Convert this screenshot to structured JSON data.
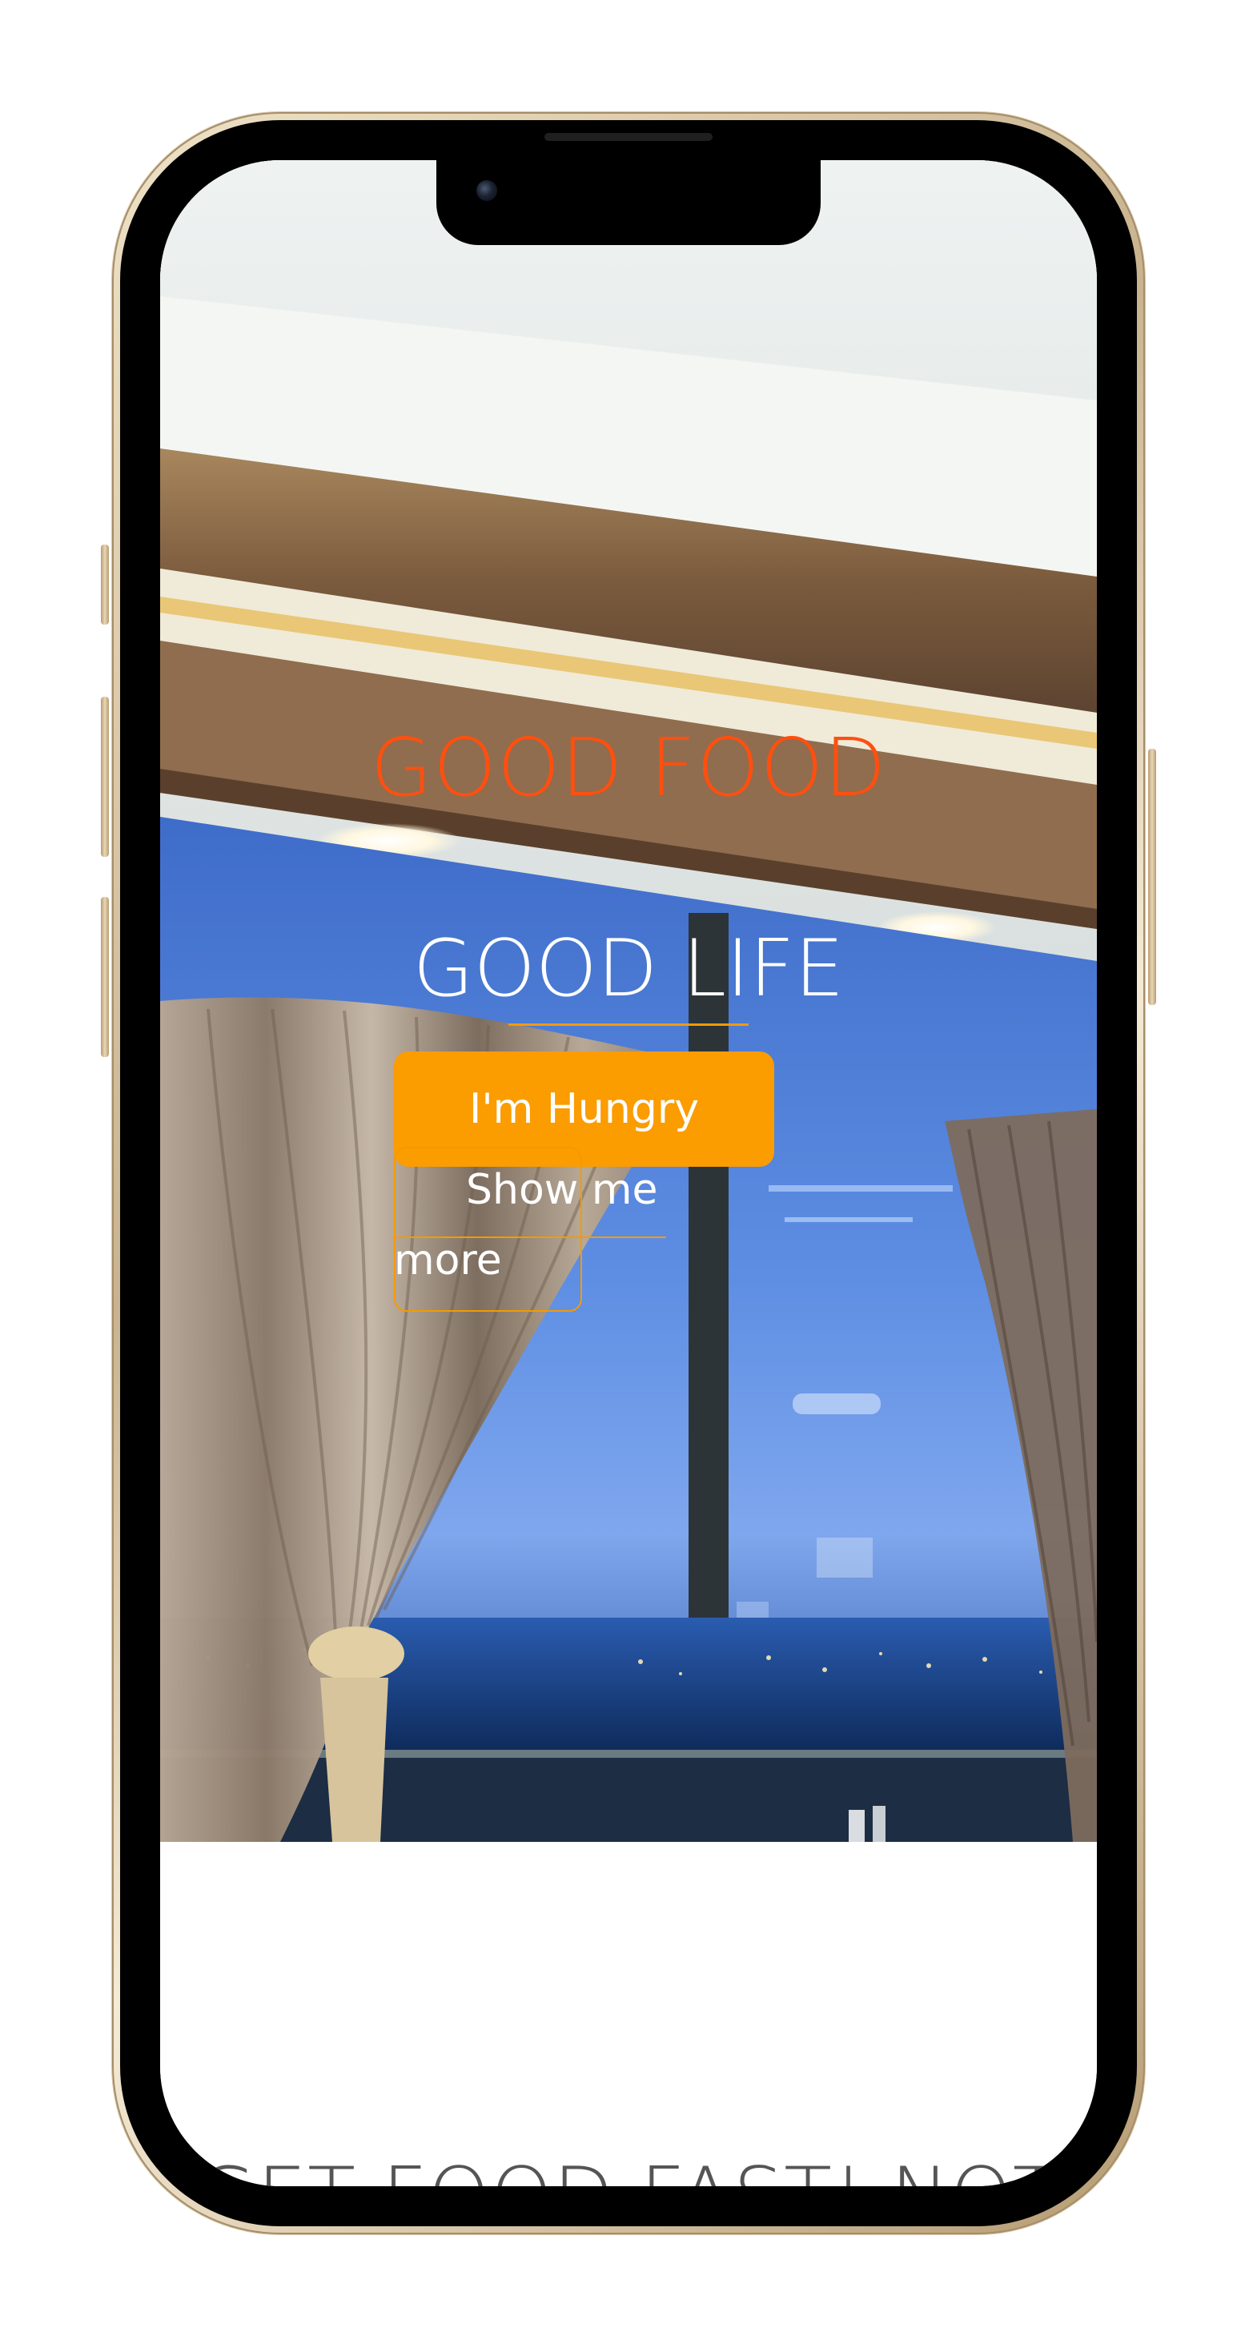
{
  "hero": {
    "title_top": "GOOD FOOD",
    "title_bottom": "GOOD LIFE",
    "primary_button": "I'm Hungry",
    "secondary_button": "Show me more"
  },
  "content": {
    "tagline": "GET FOOD FAST! NOT FAST FOOD"
  },
  "colors": {
    "accent_orange": "#FB9C00",
    "headline_red_orange": "#FF4F0F",
    "tagline_grey": "#555555",
    "device_frame_gold": "#C9B38F"
  },
  "icons": {
    "camera": "front-camera-icon"
  }
}
